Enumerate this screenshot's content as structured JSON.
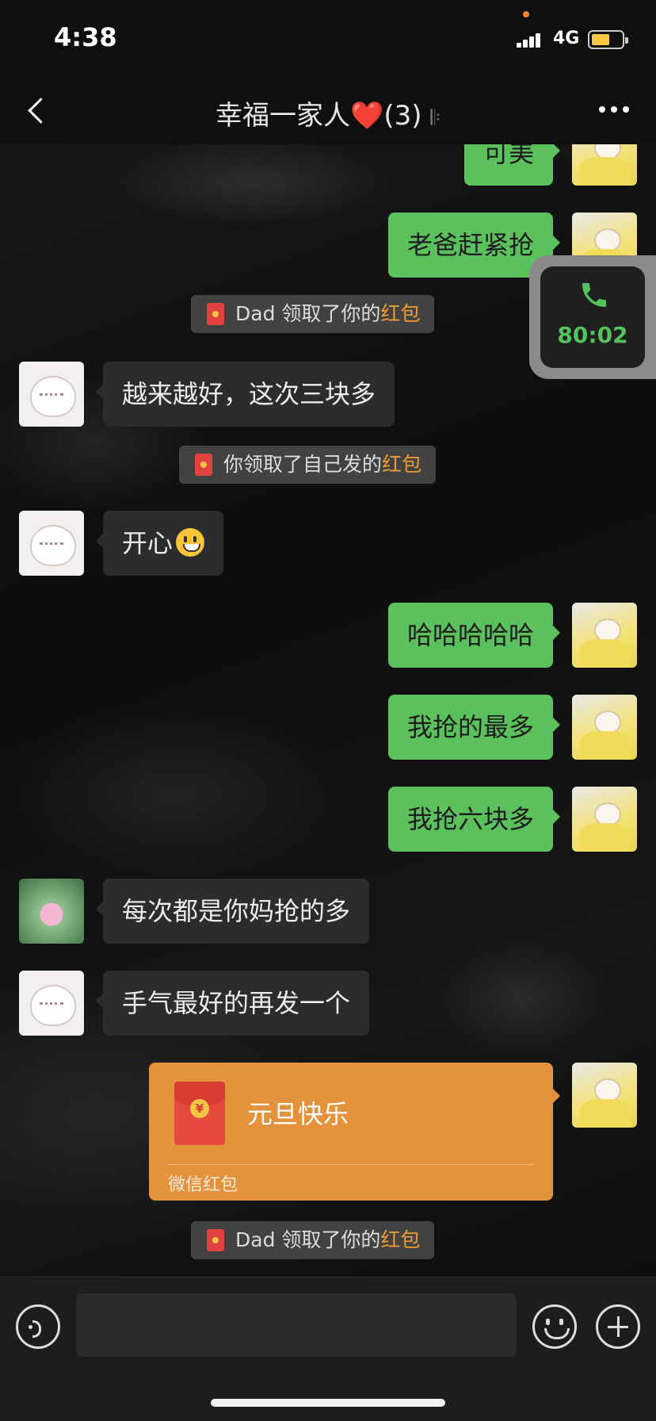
{
  "status_bar": {
    "time": "4:38",
    "network": "4G"
  },
  "header": {
    "title": "幸福一家人",
    "heart": "❤️",
    "count": "(3)"
  },
  "call_float": {
    "duration": "80:02"
  },
  "messages": [
    {
      "side": "right",
      "text": "可美"
    },
    {
      "side": "right",
      "text": "老爸赶紧抢"
    },
    {
      "type": "system",
      "prefix": "Dad 领取了你的",
      "highlight": "红包"
    },
    {
      "side": "left",
      "text": "越来越好，这次三块多"
    },
    {
      "type": "system",
      "prefix": "你领取了自己发的",
      "highlight": "红包"
    },
    {
      "side": "left",
      "text": "开心",
      "emoji": "smiley"
    },
    {
      "side": "right",
      "text": "哈哈哈哈哈"
    },
    {
      "side": "right",
      "text": "我抢的最多"
    },
    {
      "side": "right",
      "text": "我抢六块多"
    },
    {
      "side": "left",
      "text": "每次都是你妈抢的多"
    },
    {
      "side": "left",
      "text": "手气最好的再发一个"
    },
    {
      "type": "red_packet",
      "title": "元旦快乐",
      "label": "微信红包"
    },
    {
      "type": "system",
      "prefix": "Dad 领取了你的",
      "highlight": "红包"
    }
  ],
  "colors": {
    "green_bubble": "#5ac15c",
    "red_packet": "#e5923c",
    "highlight": "#f09a37",
    "call_green": "#54c25a"
  }
}
